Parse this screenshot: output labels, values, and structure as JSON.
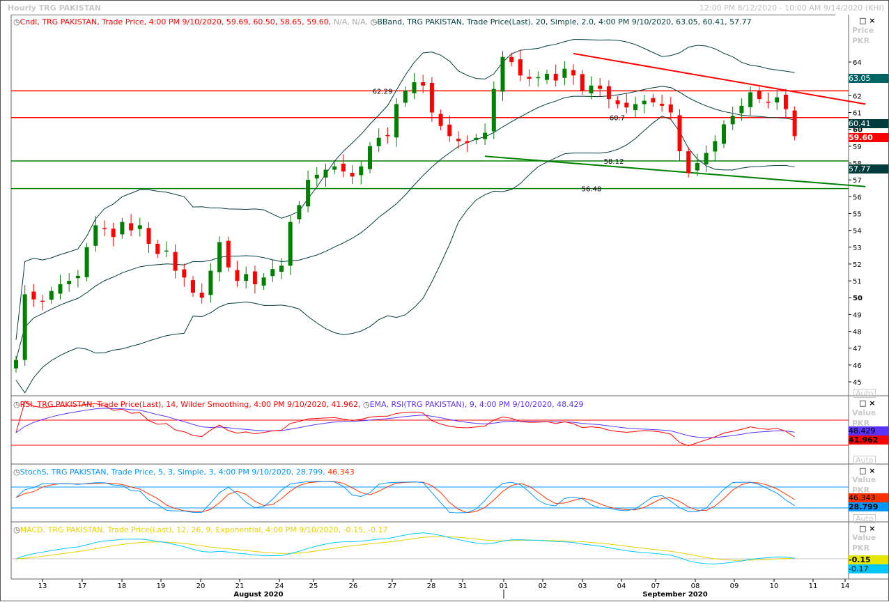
{
  "window": {
    "title": "Hourly TRG PAKISTAN",
    "range": "12:00 PM 8/12/2020 - 10:00 AM 9/14/2020 (KHI)"
  },
  "legends": {
    "cndl": "Cndl, TRG PAKISTAN, Trade Price, 4:00 PM 9/10/2020, 59.69, 60.50, 58.65, 59.60,",
    "cndl_na": "N/A, N/A,",
    "bband": "BBand, TRG PAKISTAN, Trade Price(Last), 20, Simple, 2.0, 4:00 PM 9/10/2020, 63.05, 60.41, 57.77",
    "rsi": "RSI, TRG PAKISTAN, Trade Price(Last), 14, Wilder Smoothing, 4:00 PM 9/10/2020, 41.962,",
    "ema": "EMA, RSI(TRG PAKISTAN), 9, 4:00 PM 9/10/2020, 48.429",
    "stoch": "StochS, TRG PAKISTAN, Trade Price, 5, 3, Simple, 3, 4:00 PM 9/10/2020, 28.799,",
    "stoch2": "46.343",
    "macd": "MACD, TRG PAKISTAN, Trade Price(Last), 12, 26, 9, Exponential, 4:00 PM 9/10/2020, -0.15, -0.17"
  },
  "axis": {
    "price_title": "Price",
    "unit": "PKR",
    "value_title": "Value",
    "auto": "Auto",
    "badges": {
      "bb_upper": "63.05",
      "bb_mid": "60.41",
      "last": "59.60",
      "bb_lower": "57.77",
      "ema": "48.429",
      "rsi": "41.962",
      "stoch_d": "46.343",
      "stoch_k": "28.799",
      "macd_signal": "-0.15",
      "macd": "-0.17"
    },
    "x_labels": [
      "13",
      "17",
      "18",
      "19",
      "20",
      "21",
      "24",
      "25",
      "26",
      "27",
      "28",
      "31",
      "01",
      "02",
      "03",
      "04",
      "07",
      "08",
      "09",
      "10",
      "11",
      "14"
    ],
    "months": [
      "August 2020",
      "September 2020"
    ]
  },
  "colors": {
    "up": "#008000",
    "down": "#ff0000",
    "band": "#003c3c",
    "rsi": "#ff0000",
    "ema": "#5a32ff",
    "stochK": "#0096ff",
    "stochD": "#ff3200",
    "macd": "#00c8ff",
    "signal": "#e6d200"
  },
  "chart_data": {
    "type": "candlestick",
    "ylim": [
      44.5,
      65
    ],
    "y_ticks": [
      45,
      46,
      47,
      48,
      49,
      50,
      51,
      52,
      53,
      54,
      55,
      56,
      57,
      58,
      59,
      60,
      61,
      62,
      63,
      64
    ],
    "closes": [
      46.3,
      50.2,
      49.9,
      49.8,
      50.4,
      50.8,
      51.0,
      51.3,
      53.0,
      54.3,
      54.1,
      53.6,
      54.5,
      54.0,
      54.3,
      53.2,
      52.6,
      52.8,
      51.6,
      51.2,
      50.3,
      50.0,
      51.6,
      53.3,
      51.8,
      51.0,
      51.4,
      50.8,
      51.2,
      51.7,
      51.9,
      54.5,
      55.5,
      57.0,
      57.3,
      57.6,
      57.8,
      57.5,
      57.2,
      57.8,
      59.0,
      59.5,
      59.6,
      61.5,
      62.3,
      62.8,
      62.6,
      61.0,
      60.2,
      59.6,
      59.3,
      59.2,
      59.5,
      59.8,
      62.4,
      64.3,
      64.0,
      63.2,
      63.0,
      63.1,
      63.3,
      62.9,
      63.6,
      63.2,
      62.3,
      62.6,
      62.4,
      61.8,
      61.5,
      61.3,
      61.5,
      61.7,
      61.6,
      61.4,
      61.0,
      58.7,
      57.4,
      58.0,
      58.6,
      59.3,
      60.3,
      60.8,
      61.4,
      62.2,
      61.8,
      61.6,
      61.9,
      61.2,
      59.6
    ],
    "hlines": [
      {
        "value": 62.29,
        "label": "62.29",
        "color": "#ff0000"
      },
      {
        "value": 60.7,
        "label": "60.7",
        "color": "#ff0000"
      },
      {
        "value": 58.12,
        "label": "58.12",
        "color": "#008000"
      },
      {
        "value": 56.48,
        "label": "56.48",
        "color": "#008000"
      }
    ],
    "trendlines": [
      {
        "from": [
          63,
          64.5
        ],
        "to": [
          96,
          61.5
        ],
        "color": "#ff0000"
      },
      {
        "from": [
          53,
          58.4
        ],
        "to": [
          96,
          56.6
        ],
        "color": "#008000"
      }
    ],
    "rsi_levels": [
      70,
      30
    ]
  }
}
